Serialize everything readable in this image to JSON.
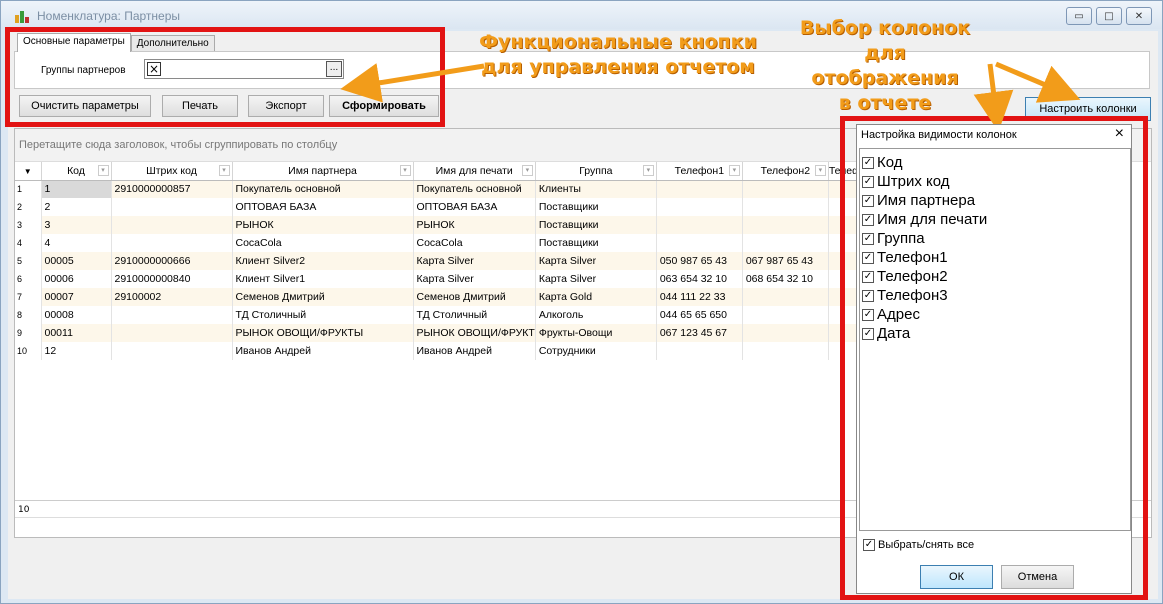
{
  "window": {
    "title": "Номенклатура: Партнеры",
    "colors": {
      "annotation": "#e21313",
      "callout": "#f29c1a"
    }
  },
  "tabs": [
    {
      "label": "Основные параметры"
    },
    {
      "label": "Дополнительно"
    }
  ],
  "filters": {
    "groups_label": "Группы партнеров",
    "groups_value": ""
  },
  "buttons": {
    "clear": "Очистить параметры",
    "print": "Печать",
    "export": "Экспорт",
    "generate": "Сформировать",
    "configure_columns": "Настроить колонки"
  },
  "grid": {
    "group_hint": "Перетащите сюда заголовок, чтобы сгруппировать по столбцу",
    "columns": [
      "Код",
      "Штрих код",
      "Имя партнера",
      "Имя для печати",
      "Группа",
      "Телефон1",
      "Телефон2",
      "Телеф"
    ],
    "rows": [
      {
        "n": "1",
        "code": "1",
        "barcode": "2910000000857",
        "name": "Покупатель основной",
        "print": "Покупатель основной",
        "group": "Клиенты",
        "phone1": "",
        "phone2": ""
      },
      {
        "n": "2",
        "code": "2",
        "barcode": "",
        "name": "ОПТОВАЯ БАЗА",
        "print": "ОПТОВАЯ БАЗА",
        "group": "Поставщики",
        "phone1": "",
        "phone2": ""
      },
      {
        "n": "3",
        "code": "3",
        "barcode": "",
        "name": "РЫНОК",
        "print": "РЫНОК",
        "group": "Поставщики",
        "phone1": "",
        "phone2": ""
      },
      {
        "n": "4",
        "code": "4",
        "barcode": "",
        "name": "CocaCola",
        "print": "CocaCola",
        "group": "Поставщики",
        "phone1": "",
        "phone2": ""
      },
      {
        "n": "5",
        "code": "00005",
        "barcode": "2910000000666",
        "name": "Клиент Silver2",
        "print": "Карта Silver",
        "group": "Карта Silver",
        "phone1": "050 987 65 43",
        "phone2": "067 987 65 43"
      },
      {
        "n": "6",
        "code": "00006",
        "barcode": "2910000000840",
        "name": "Клиент Silver1",
        "print": "Карта Silver",
        "group": "Карта Silver",
        "phone1": "063 654 32 10",
        "phone2": "068 654 32 10"
      },
      {
        "n": "7",
        "code": "00007",
        "barcode": "29100002",
        "name": "Семенов Дмитрий",
        "print": "Семенов Дмитрий",
        "group": "Карта Gold",
        "phone1": "044 111 22 33",
        "phone2": ""
      },
      {
        "n": "8",
        "code": "00008",
        "barcode": "",
        "name": "ТД Столичный",
        "print": "ТД Столичный",
        "group": "Алкоголь",
        "phone1": "044 65 65 650",
        "phone2": ""
      },
      {
        "n": "9",
        "code": "00011",
        "barcode": "",
        "name": "РЫНОК ОВОЩИ/ФРУКТЫ",
        "print": "РЫНОК ОВОЩИ/ФРУКТ",
        "group": "Фрукты-Овощи",
        "phone1": "067 123 45 67",
        "phone2": ""
      },
      {
        "n": "10",
        "code": "12",
        "barcode": "",
        "name": "Иванов Андрей",
        "print": "Иванов Андрей",
        "group": "Сотрудники",
        "phone1": "",
        "phone2": ""
      }
    ],
    "footer_count": "10"
  },
  "popup": {
    "title": "Настройка видимости колонок",
    "columns": [
      {
        "label": "Код",
        "checked": true
      },
      {
        "label": "Штрих код",
        "checked": true
      },
      {
        "label": "Имя партнера",
        "checked": true
      },
      {
        "label": "Имя для печати",
        "checked": true
      },
      {
        "label": "Группа",
        "checked": true
      },
      {
        "label": "Телефон1",
        "checked": true
      },
      {
        "label": "Телефон2",
        "checked": true
      },
      {
        "label": "Телефон3",
        "checked": true
      },
      {
        "label": "Адрес",
        "checked": true
      },
      {
        "label": "Дата",
        "checked": true
      }
    ],
    "select_all": "Выбрать/снять все",
    "ok": "ОК",
    "cancel": "Отмена"
  },
  "annotations": {
    "functions_line1": "Функциональные кнопки",
    "functions_line2": "для управления отчетом",
    "columns_line1": "Выбор колонок",
    "columns_line2": "для отображения",
    "columns_line3": "в отчете"
  }
}
